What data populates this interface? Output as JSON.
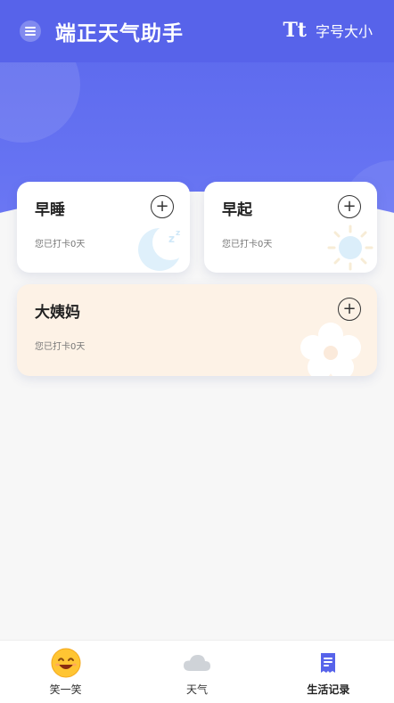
{
  "header": {
    "title": "端正天气助手",
    "font_size_icon": "Tt",
    "font_size_label": "字号大小",
    "menu_icon": "menu-icon"
  },
  "cards": [
    {
      "title": "早睡",
      "subtitle": "您已打卡0天",
      "icon": "moon-icon"
    },
    {
      "title": "早起",
      "subtitle": "您已打卡0天",
      "icon": "sun-icon"
    },
    {
      "title": "大姨妈",
      "subtitle": "您已打卡0天",
      "icon": "flower-icon"
    }
  ],
  "tabs": [
    {
      "label": "笑一笑",
      "icon": "smile-emoji-icon",
      "active": false
    },
    {
      "label": "天气",
      "icon": "cloud-icon",
      "active": false
    },
    {
      "label": "生活记录",
      "icon": "document-icon",
      "active": true
    }
  ],
  "colors": {
    "primary": "#5763ea",
    "card_warm": "#fdf2e6",
    "background": "#f7f7f7"
  }
}
